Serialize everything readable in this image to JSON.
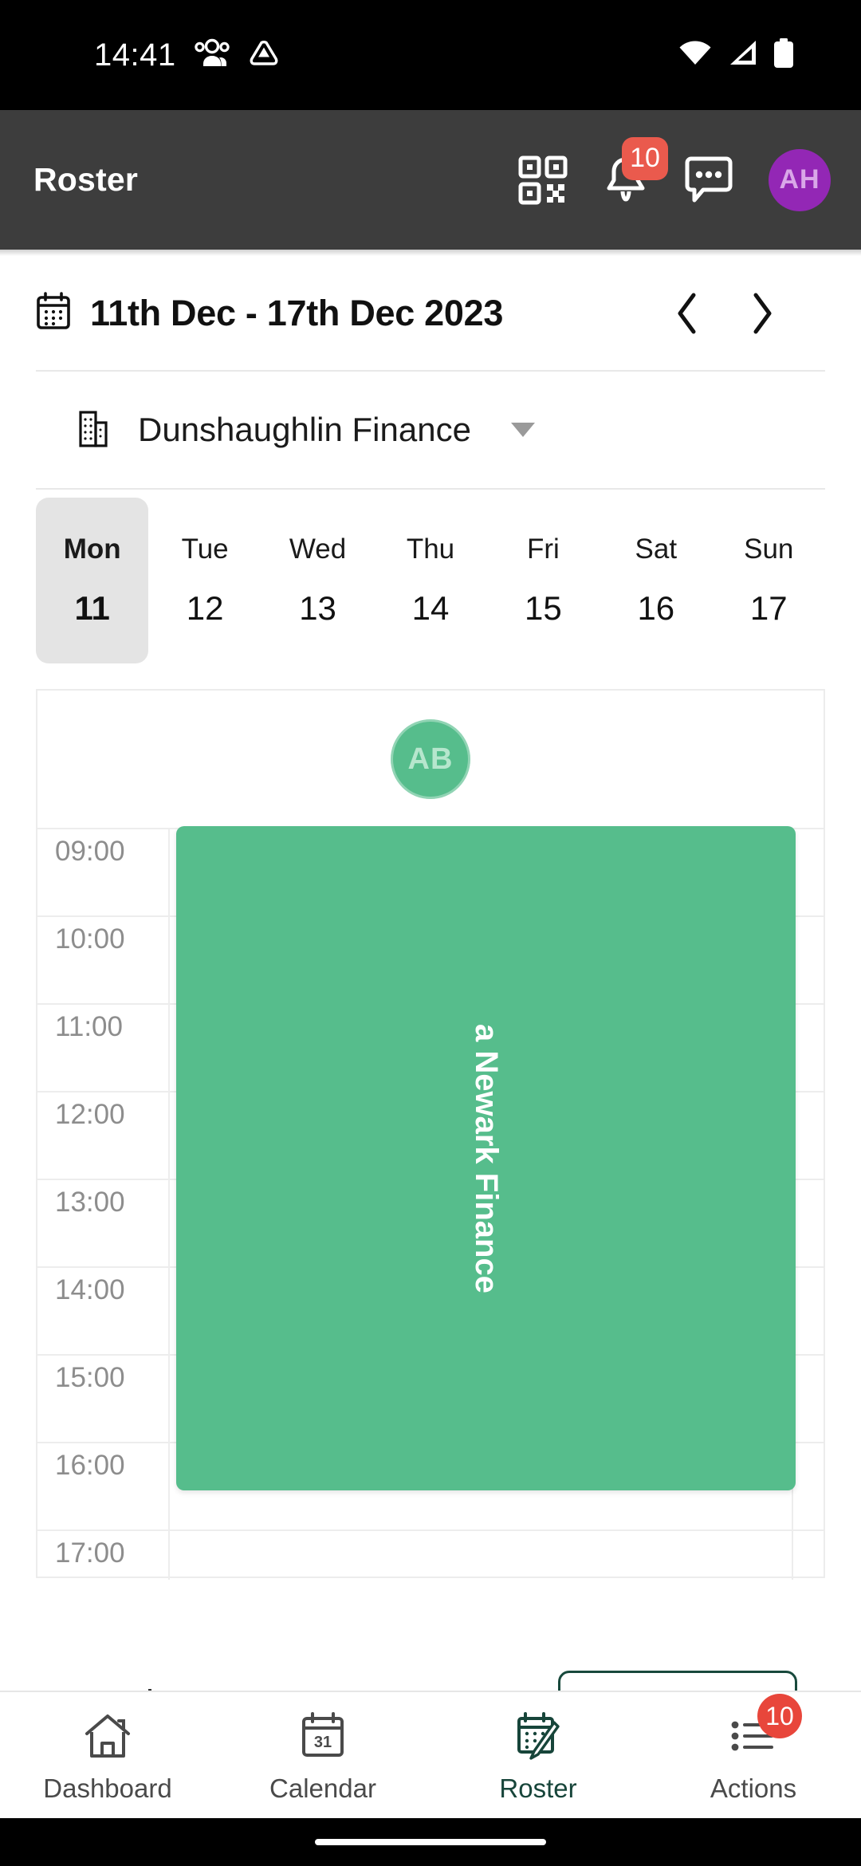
{
  "status_bar": {
    "time": "14:41",
    "left_icons": [
      "people-icon",
      "triangle-app-icon"
    ],
    "right_icons": [
      "wifi-icon",
      "cellular-signal-icon",
      "battery-icon"
    ]
  },
  "app_bar": {
    "title": "Roster",
    "qr_icon": "qr-code-icon",
    "notifications_icon": "bell-icon",
    "notifications_badge": "10",
    "messages_icon": "chat-bubble-icon",
    "avatar_initials": "AH",
    "avatar_color": "#9327b5",
    "background_color": "#3d3d3d"
  },
  "date_nav": {
    "calendar_icon": "calendar-icon",
    "range_label": "11th Dec - 17th Dec 2023",
    "prev_icon": "chevron-left-icon",
    "next_icon": "chevron-right-icon"
  },
  "location": {
    "building_icon": "building-icon",
    "name": "Dunshaughlin Finance",
    "dropdown_icon": "caret-down-icon"
  },
  "week_days": [
    {
      "name": "Mon",
      "date": "11",
      "selected": true
    },
    {
      "name": "Tue",
      "date": "12",
      "selected": false
    },
    {
      "name": "Wed",
      "date": "13",
      "selected": false
    },
    {
      "name": "Thu",
      "date": "14",
      "selected": false
    },
    {
      "name": "Fri",
      "date": "15",
      "selected": false
    },
    {
      "name": "Sat",
      "date": "16",
      "selected": false
    },
    {
      "name": "Sun",
      "date": "17",
      "selected": false
    }
  ],
  "schedule": {
    "employee_initials": "AB",
    "employee_avatar_color": "#56bd8c",
    "hours": [
      "09:00",
      "10:00",
      "11:00",
      "12:00",
      "13:00",
      "14:00",
      "15:00",
      "16:00",
      "17:00"
    ],
    "shift": {
      "label": "a Newark Finance",
      "color": "#56bd8c",
      "start_hour": "09:00",
      "end_hour": "17:00"
    }
  },
  "bottom_nav": {
    "items": [
      {
        "label": "Dashboard",
        "icon": "home-icon",
        "active": false,
        "badge": ""
      },
      {
        "label": "Calendar",
        "icon": "calendar-31-icon",
        "active": false,
        "badge": ""
      },
      {
        "label": "Roster",
        "icon": "roster-pen-icon",
        "active": true,
        "badge": ""
      },
      {
        "label": "Actions",
        "icon": "list-icon",
        "active": false,
        "badge": "10"
      }
    ],
    "active_color": "#17453a",
    "badge_color": "#e8463b"
  }
}
